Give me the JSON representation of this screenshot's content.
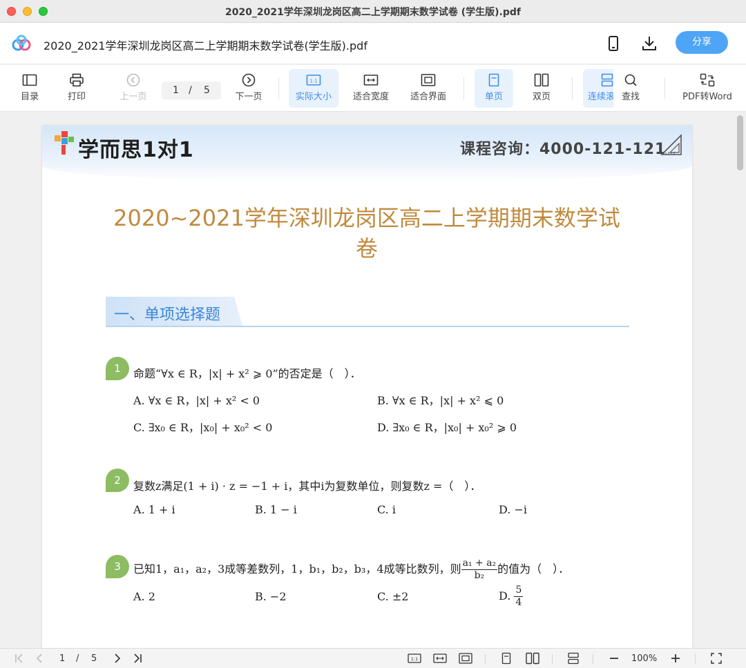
{
  "window": {
    "title": "2020_2021学年深圳龙岗区高二上学期期末数学试卷 (学生版).pdf"
  },
  "header": {
    "doc_title": "2020_2021学年深圳龙岗区高二上学期期末数学试卷(学生版).pdf",
    "share_label": "分享",
    "icons": [
      "phone-icon",
      "download-icon"
    ]
  },
  "toolbar": {
    "toc": "目录",
    "print": "打印",
    "prev": "上一页",
    "page_current": "1",
    "page_sep": "/",
    "page_total": "5",
    "next": "下一页",
    "actual_size": "实际大小",
    "fit_width": "适合宽度",
    "fit_page": "适合界面",
    "single_page": "单页",
    "double_page": "双页",
    "continuous": "连续滚",
    "find": "查找",
    "pdf_to_word": "PDF转Word"
  },
  "page": {
    "brand": "学而思1对1",
    "consult": "课程咨询：4000-121-121",
    "title": "2020~2021学年深圳龙岗区高二上学期期末数学试卷",
    "section": "一、单项选择题",
    "questions": [
      {
        "num": "1",
        "text": "命题“∀x ∈ R，|x| + x² ⩾ 0”的否定是（　）．",
        "options": [
          "A.  ∀x ∈ R，|x| + x² < 0",
          "B.  ∀x ∈ R，|x| + x² ⩽ 0",
          "C.  ∃x₀ ∈ R，|x₀| + x₀² < 0",
          "D.  ∃x₀ ∈ R，|x₀| + x₀² ⩾ 0"
        ]
      },
      {
        "num": "2",
        "text": "复数z满足(1 + i) · z = −1 + i，其中i为复数单位，则复数z =（　）．",
        "options": [
          "A.  1 + i",
          "B.  1 − i",
          "C.  i",
          "D.  −i"
        ]
      },
      {
        "num": "3",
        "text_before": "已知1，a₁，a₂，3成等差数列，1，b₁，b₂，b₃，4成等比数列，则",
        "frac_num": "a₁ + a₂",
        "frac_den": "b₂",
        "text_after": "的值为（　）．",
        "options": [
          "A.  2",
          "B.  −2",
          "C.  ±2"
        ],
        "option_d_label": "D.",
        "option_d_num": "5",
        "option_d_den": "4"
      }
    ]
  },
  "statusbar": {
    "page_current": "1",
    "page_sep": "/",
    "page_total": "5",
    "zoom": "100%"
  },
  "colors": {
    "accent": "#4ea4f5",
    "title": "#c08a3e",
    "section": "#3b86d9",
    "qbadge": "#8dbc63"
  }
}
